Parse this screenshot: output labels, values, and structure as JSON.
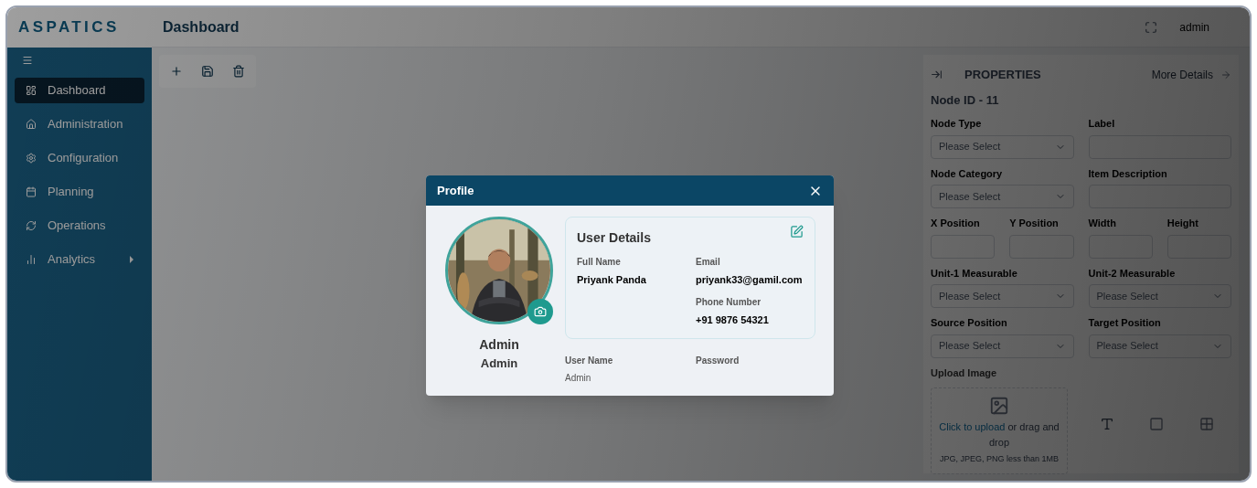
{
  "header": {
    "logo": "ASPATICS",
    "title": "Dashboard",
    "user": "admin"
  },
  "sidebar": {
    "items": [
      {
        "label": "Dashboard",
        "selected": true,
        "submenu": false
      },
      {
        "label": "Administration",
        "selected": false,
        "submenu": false
      },
      {
        "label": "Configuration",
        "selected": false,
        "submenu": false
      },
      {
        "label": "Planning",
        "selected": false,
        "submenu": false
      },
      {
        "label": "Operations",
        "selected": false,
        "submenu": false
      },
      {
        "label": "Analytics",
        "selected": false,
        "submenu": true
      }
    ]
  },
  "properties": {
    "title": "PROPERTIES",
    "link": "More Details",
    "node_id": "Node ID - 11",
    "rows": [
      [
        {
          "label": "Node Type",
          "kind": "select",
          "placeholder": "Please Select"
        },
        {
          "label": "Label",
          "kind": "text"
        }
      ],
      [
        {
          "label": "Node Category",
          "kind": "select",
          "placeholder": "Please Select"
        },
        {
          "label": "Item Description",
          "kind": "text"
        }
      ],
      [
        {
          "label": "X Position",
          "kind": "text"
        },
        {
          "label": "Y Position",
          "kind": "text"
        },
        {
          "label": "Width",
          "kind": "text"
        },
        {
          "label": "Height",
          "kind": "text"
        }
      ],
      [
        {
          "label": "Unit-1 Measurable",
          "kind": "select",
          "placeholder": "Please Select"
        },
        {
          "label": "Unit-2 Measurable",
          "kind": "select",
          "placeholder": "Please Select"
        }
      ],
      [
        {
          "label": "Source Position",
          "kind": "select",
          "placeholder": "Please Select"
        },
        {
          "label": "Target Position",
          "kind": "select",
          "placeholder": "Please Select"
        }
      ]
    ],
    "upload": {
      "label": "Upload Image",
      "link": "Click to upload",
      "text": "or drag and drop",
      "hint": "JPG, JPEG, PNG less than 1MB"
    }
  },
  "profile": {
    "title": "Profile",
    "name": "Admin",
    "role": "Admin",
    "details_title": "User Details",
    "details": [
      {
        "label": "Full Name",
        "value": "Priyank Panda"
      },
      {
        "label": "Email",
        "value": "priyank33@gamil.com"
      },
      {
        "label": "Phone Number",
        "value": "+91 9876 54321"
      }
    ],
    "account": [
      {
        "label": "User Name",
        "value": "Admin"
      },
      {
        "label": "Password"
      }
    ]
  }
}
